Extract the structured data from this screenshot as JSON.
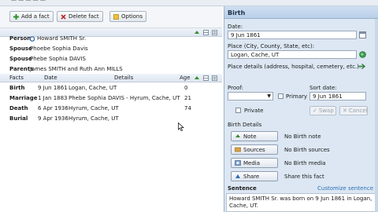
{
  "toolbar": {
    "add_fact": "Add a fact",
    "delete_fact": "Delete fact",
    "options": "Options"
  },
  "family": {
    "rows": [
      {
        "label": "Person",
        "value": "Howard SMITH Sr."
      },
      {
        "label": "Spouse",
        "value": "Phoebe Sophia Davis"
      },
      {
        "label": "Spouse",
        "value": "Phebe Sophia DAVIS"
      },
      {
        "label": "Parents",
        "value": "James SMITH and Ruth Ann MILLS"
      }
    ]
  },
  "facts": {
    "headers": {
      "facts": "Facts",
      "date": "Date",
      "details": "Details",
      "age": "Age"
    },
    "rows": [
      {
        "type": "Birth",
        "date": "9 Jun 1861",
        "details": "Logan, Cache, UT",
        "age": "0"
      },
      {
        "type": "Marriage",
        "date": "1 Jan 1883",
        "details": "Phebe Sophia DAVIS - Hyrum, Cache, UT",
        "age": "21"
      },
      {
        "type": "Death",
        "date": "6 Apr 1936",
        "details": "Hyrum, Cache, UT",
        "age": "74"
      },
      {
        "type": "Burial",
        "date": "9 Apr 1936",
        "details": "Hyrum, Cache, UT",
        "age": ""
      }
    ]
  },
  "panel": {
    "title": "Birth",
    "date_label": "Date:",
    "date_value": "9 Jun 1861",
    "place_label": "Place (City, County, State, etc):",
    "place_value": "Logan, Cache, UT",
    "place_details_label": "Place details (address, hospital, cemetery, etc.):",
    "proof_label": "Proof:",
    "primary_label": "Primary",
    "sort_date_label": "Sort date:",
    "sort_date_value": "9 Jun 1861",
    "private_label": "Private",
    "swap_label": "Swap",
    "cancel_label": "Cancel",
    "birth_details_label": "Birth Details",
    "note_btn": "Note",
    "note_text": "No Birth note",
    "sources_btn": "Sources",
    "sources_text": "No Birth sources",
    "media_btn": "Media",
    "media_text": "No Birth media",
    "share_btn": "Share",
    "share_text": "Share this fact",
    "sentence_label": "Sentence",
    "customize_label": "Customize sentence",
    "sentence_text": "Howard SMITH Sr. was born on 9 Jun 1861 in Logan, Cache, UT."
  },
  "colors": {
    "accent": "#2a6fb8",
    "green_icon": "#3a8a2e"
  }
}
